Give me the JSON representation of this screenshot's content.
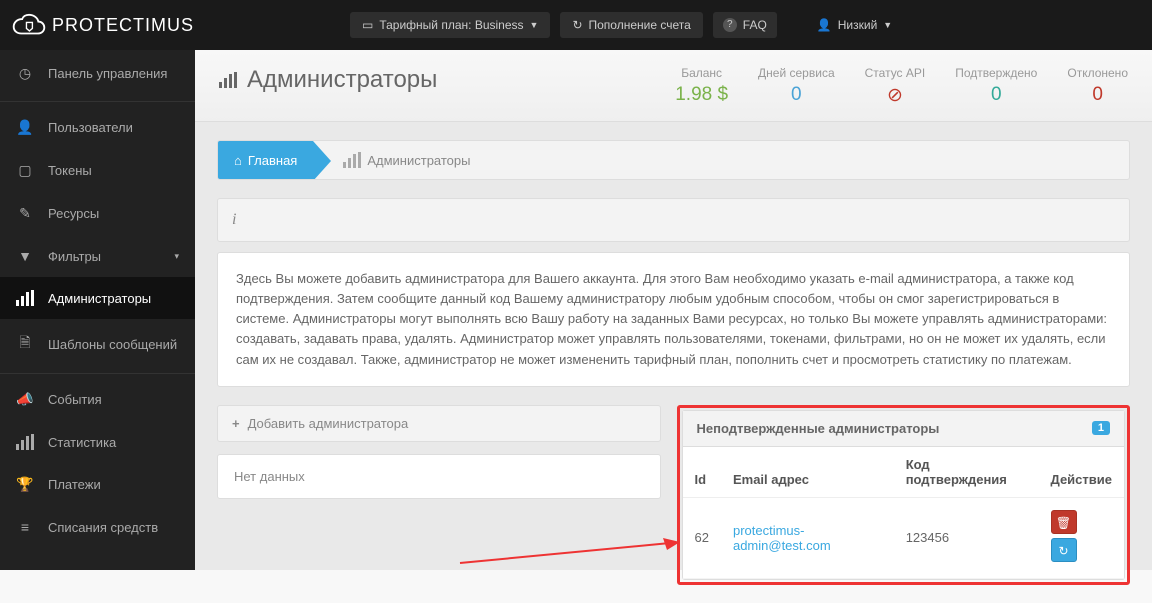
{
  "brand": "PROTECTIMUS",
  "topbar": {
    "plan_label": "Тарифный план: Business",
    "topup_label": "Пополнение счета",
    "faq_label": "FAQ",
    "user_label": "Низкий"
  },
  "sidebar": {
    "dashboard": "Панель управления",
    "users": "Пользователи",
    "tokens": "Токены",
    "resources": "Ресурсы",
    "filters": "Фильтры",
    "admins": "Администраторы",
    "templates": "Шаблоны сообщений",
    "events": "События",
    "stats": "Статистика",
    "payments": "Платежи",
    "debits": "Списания средств"
  },
  "page": {
    "title": "Администраторы",
    "crumb_home": "Главная",
    "crumb_current": "Администраторы",
    "info_icon_present": true,
    "description": "Здесь Вы можете добавить администратора для Вашего аккаунта. Для этого Вам необходимо указать e-mail администратора, а также код подтверждения. Затем сообщите данный код Вашему администратору любым удобным способом, чтобы он смог зарегистрироваться в системе. Администраторы могут выполнять всю Вашу работу на заданных Вами ресурсах, но только Вы можете управлять администраторами: создавать, задавать права, удалять. Администратор может управлять пользователями, токенами, фильтрами, но он не может их удалять, если сам их не создавал. Также, администратор не может измененить тарифный план, пополнить счет и просмотреть статистику по платежам.",
    "add_admin_label": "Добавить администратора",
    "no_data": "Нет данных"
  },
  "stats": {
    "balance_label": "Баланс",
    "balance_value": "1.98 $",
    "days_label": "Дней сервиса",
    "days_value": "0",
    "api_label": "Статус API",
    "api_value": "⊘",
    "confirmed_label": "Подтверждено",
    "confirmed_value": "0",
    "rejected_label": "Отклонено",
    "rejected_value": "0"
  },
  "pending_panel": {
    "title": "Неподтвержденные администраторы",
    "badge": "1",
    "columns": {
      "id": "Id",
      "email": "Email адрес",
      "code": "Код подтверждения",
      "action": "Действие"
    },
    "rows": [
      {
        "id": "62",
        "email": "protectimus-admin@test.com",
        "code": "123456"
      }
    ]
  }
}
